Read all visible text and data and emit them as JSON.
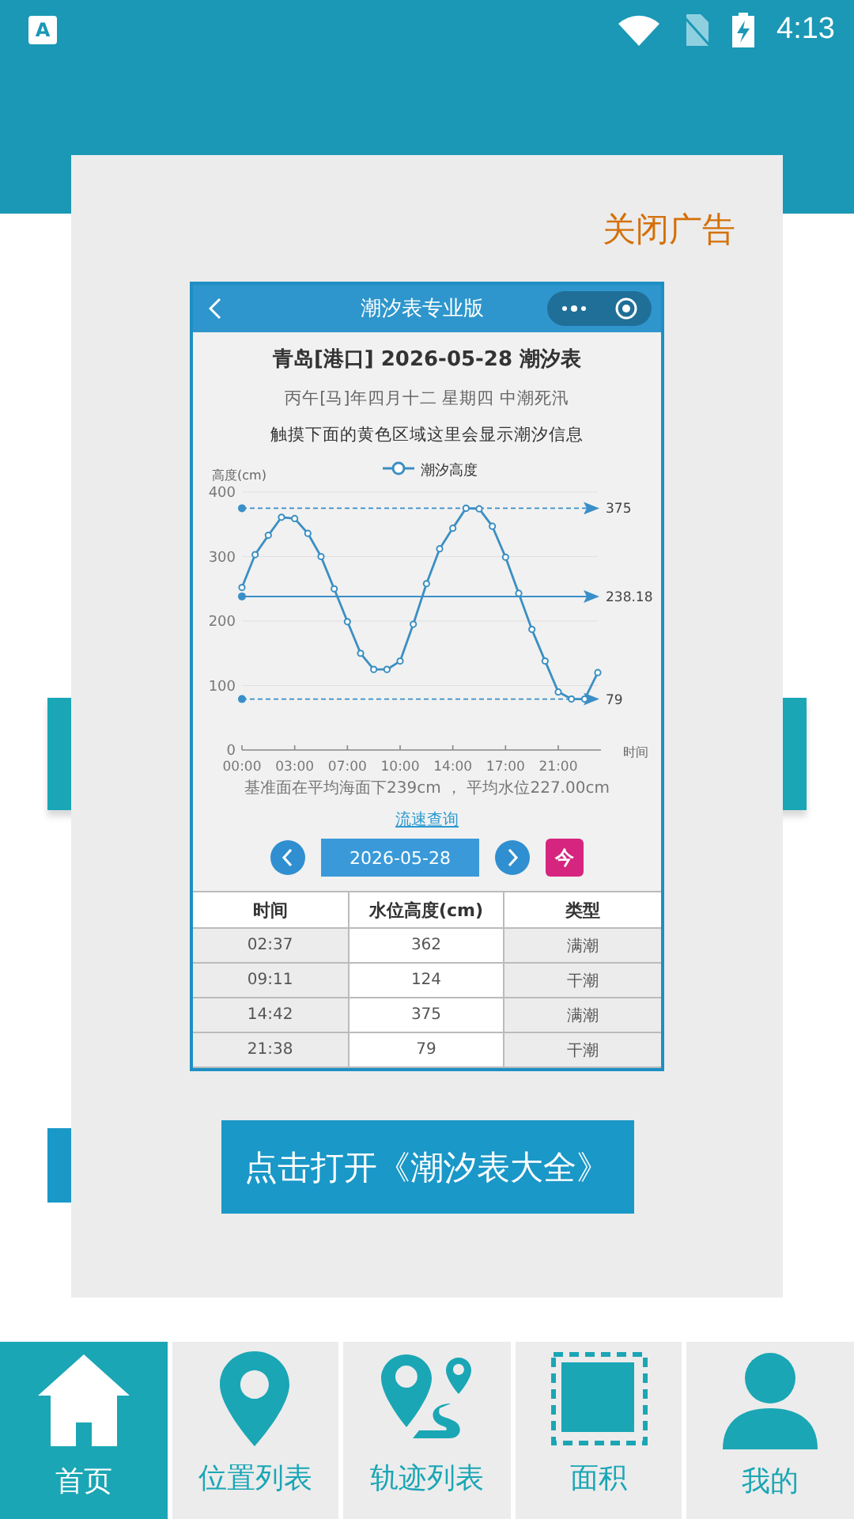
{
  "status_bar": {
    "app_badge": "A",
    "time": "4:13"
  },
  "ad": {
    "close_label": "关闭广告",
    "open_button": "点击打开《潮汐表大全》",
    "preview": {
      "header_title": "潮汐表专业版",
      "title": "青岛[港口] 2026-05-28 潮汐表",
      "lunar": "丙午[马]年四月十二 星期四 中潮死汛",
      "hint": "触摸下面的黄色区域这里会显示潮汐信息",
      "chart_data": {
        "type": "line",
        "ylabel": "高度(cm)",
        "xlabel": "时间",
        "categories": [
          "00:00",
          null,
          null,
          null,
          "03:00",
          null,
          null,
          null,
          "07:00",
          null,
          null,
          null,
          "10:00",
          null,
          null,
          null,
          "14:00",
          null,
          null,
          null,
          "17:00",
          null,
          null,
          null,
          "21:00",
          null,
          null,
          null
        ],
        "grid": true,
        "series": [
          {
            "name": "潮汐高度",
            "color": "#3b8fc2",
            "marker": "o",
            "values": [
              252,
              303,
              333,
              361,
              359,
              336,
              300,
              250,
              199,
              150,
              125,
              125,
              138,
              195,
              258,
              312,
              344,
              375,
              374,
              347,
              299,
              243,
              187,
              138,
              90,
              79,
              79,
              120
            ]
          }
        ],
        "ylim": [
          0,
          400
        ],
        "yticks": [
          0,
          100,
          200,
          300,
          400
        ],
        "ref_lines": [
          {
            "axis": "y",
            "value": 375,
            "label": "375",
            "color": "#3a8fc8"
          },
          {
            "axis": "y",
            "value": 238.18,
            "label": "238.18",
            "color": "#3a8fc8"
          },
          {
            "axis": "y",
            "value": 79,
            "label": "79",
            "color": "#3a8fc8"
          }
        ]
      },
      "note": "基准面在平均海面下239cm ， 平均水位227.00cm",
      "link": "流速查询",
      "date": "2026-05-28",
      "today_label": "今",
      "table": {
        "columns": [
          "时间",
          "水位高度(cm)",
          "类型"
        ],
        "rows": [
          [
            "02:37",
            "362",
            "满潮"
          ],
          [
            "09:11",
            "124",
            "干潮"
          ],
          [
            "14:42",
            "375",
            "满潮"
          ],
          [
            "21:38",
            "79",
            "干潮"
          ]
        ]
      }
    }
  },
  "nav": [
    {
      "label": "首页",
      "kind": "home",
      "selected": true
    },
    {
      "label": "位置列表",
      "kind": "pin",
      "selected": false
    },
    {
      "label": "轨迹列表",
      "kind": "route",
      "selected": false
    },
    {
      "label": "面积",
      "kind": "area",
      "selected": false
    },
    {
      "label": "我的",
      "kind": "person",
      "selected": false
    }
  ]
}
